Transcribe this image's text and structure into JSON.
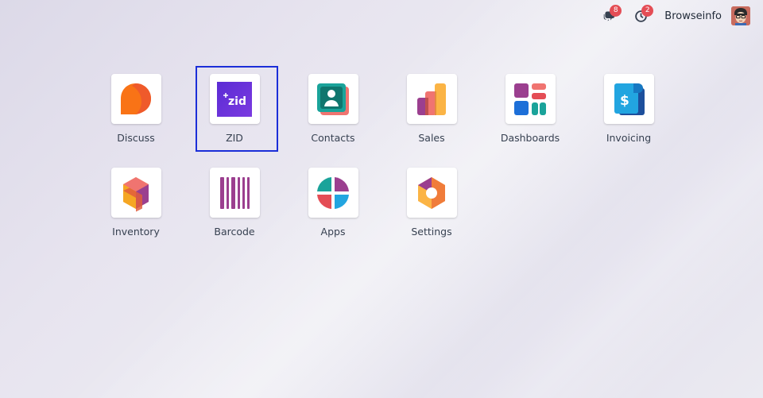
{
  "topbar": {
    "messages_badge": "8",
    "activity_badge": "2",
    "company_name": "Browseinfo"
  },
  "apps": [
    {
      "label": "Discuss",
      "icon": "discuss-icon"
    },
    {
      "label": "ZID",
      "icon": "zid-icon",
      "icon_text": "zid"
    },
    {
      "label": "Contacts",
      "icon": "contacts-icon"
    },
    {
      "label": "Sales",
      "icon": "sales-icon"
    },
    {
      "label": "Dashboards",
      "icon": "dashboards-icon"
    },
    {
      "label": "Invoicing",
      "icon": "invoicing-icon",
      "icon_text": "$"
    },
    {
      "label": "Inventory",
      "icon": "inventory-icon"
    },
    {
      "label": "Barcode",
      "icon": "barcode-icon"
    },
    {
      "label": "Apps",
      "icon": "apps-icon"
    },
    {
      "label": "Settings",
      "icon": "settings-icon"
    }
  ],
  "colors": {
    "selection_border": "#1b2ed8",
    "badge": "#e44d55"
  }
}
